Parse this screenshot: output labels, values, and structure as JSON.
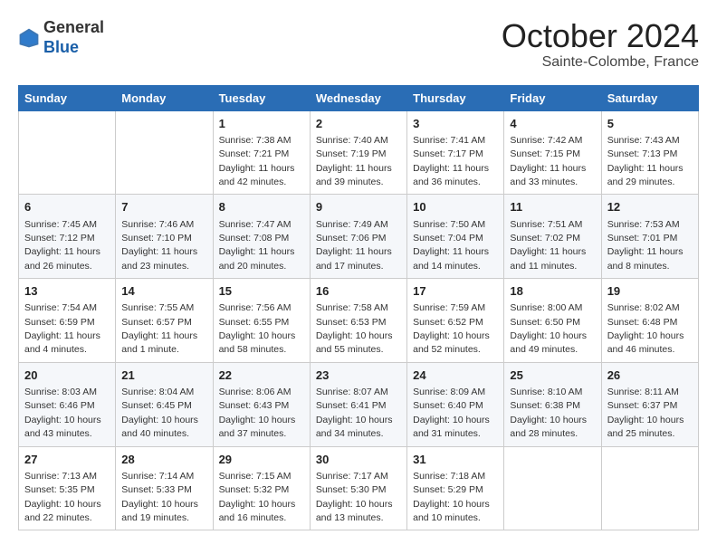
{
  "header": {
    "logo_general": "General",
    "logo_blue": "Blue",
    "month_title": "October 2024",
    "location": "Sainte-Colombe, France"
  },
  "days_of_week": [
    "Sunday",
    "Monday",
    "Tuesday",
    "Wednesday",
    "Thursday",
    "Friday",
    "Saturday"
  ],
  "weeks": [
    [
      {
        "day": "",
        "info": ""
      },
      {
        "day": "",
        "info": ""
      },
      {
        "day": "1",
        "info": "Sunrise: 7:38 AM\nSunset: 7:21 PM\nDaylight: 11 hours and 42 minutes."
      },
      {
        "day": "2",
        "info": "Sunrise: 7:40 AM\nSunset: 7:19 PM\nDaylight: 11 hours and 39 minutes."
      },
      {
        "day": "3",
        "info": "Sunrise: 7:41 AM\nSunset: 7:17 PM\nDaylight: 11 hours and 36 minutes."
      },
      {
        "day": "4",
        "info": "Sunrise: 7:42 AM\nSunset: 7:15 PM\nDaylight: 11 hours and 33 minutes."
      },
      {
        "day": "5",
        "info": "Sunrise: 7:43 AM\nSunset: 7:13 PM\nDaylight: 11 hours and 29 minutes."
      }
    ],
    [
      {
        "day": "6",
        "info": "Sunrise: 7:45 AM\nSunset: 7:12 PM\nDaylight: 11 hours and 26 minutes."
      },
      {
        "day": "7",
        "info": "Sunrise: 7:46 AM\nSunset: 7:10 PM\nDaylight: 11 hours and 23 minutes."
      },
      {
        "day": "8",
        "info": "Sunrise: 7:47 AM\nSunset: 7:08 PM\nDaylight: 11 hours and 20 minutes."
      },
      {
        "day": "9",
        "info": "Sunrise: 7:49 AM\nSunset: 7:06 PM\nDaylight: 11 hours and 17 minutes."
      },
      {
        "day": "10",
        "info": "Sunrise: 7:50 AM\nSunset: 7:04 PM\nDaylight: 11 hours and 14 minutes."
      },
      {
        "day": "11",
        "info": "Sunrise: 7:51 AM\nSunset: 7:02 PM\nDaylight: 11 hours and 11 minutes."
      },
      {
        "day": "12",
        "info": "Sunrise: 7:53 AM\nSunset: 7:01 PM\nDaylight: 11 hours and 8 minutes."
      }
    ],
    [
      {
        "day": "13",
        "info": "Sunrise: 7:54 AM\nSunset: 6:59 PM\nDaylight: 11 hours and 4 minutes."
      },
      {
        "day": "14",
        "info": "Sunrise: 7:55 AM\nSunset: 6:57 PM\nDaylight: 11 hours and 1 minute."
      },
      {
        "day": "15",
        "info": "Sunrise: 7:56 AM\nSunset: 6:55 PM\nDaylight: 10 hours and 58 minutes."
      },
      {
        "day": "16",
        "info": "Sunrise: 7:58 AM\nSunset: 6:53 PM\nDaylight: 10 hours and 55 minutes."
      },
      {
        "day": "17",
        "info": "Sunrise: 7:59 AM\nSunset: 6:52 PM\nDaylight: 10 hours and 52 minutes."
      },
      {
        "day": "18",
        "info": "Sunrise: 8:00 AM\nSunset: 6:50 PM\nDaylight: 10 hours and 49 minutes."
      },
      {
        "day": "19",
        "info": "Sunrise: 8:02 AM\nSunset: 6:48 PM\nDaylight: 10 hours and 46 minutes."
      }
    ],
    [
      {
        "day": "20",
        "info": "Sunrise: 8:03 AM\nSunset: 6:46 PM\nDaylight: 10 hours and 43 minutes."
      },
      {
        "day": "21",
        "info": "Sunrise: 8:04 AM\nSunset: 6:45 PM\nDaylight: 10 hours and 40 minutes."
      },
      {
        "day": "22",
        "info": "Sunrise: 8:06 AM\nSunset: 6:43 PM\nDaylight: 10 hours and 37 minutes."
      },
      {
        "day": "23",
        "info": "Sunrise: 8:07 AM\nSunset: 6:41 PM\nDaylight: 10 hours and 34 minutes."
      },
      {
        "day": "24",
        "info": "Sunrise: 8:09 AM\nSunset: 6:40 PM\nDaylight: 10 hours and 31 minutes."
      },
      {
        "day": "25",
        "info": "Sunrise: 8:10 AM\nSunset: 6:38 PM\nDaylight: 10 hours and 28 minutes."
      },
      {
        "day": "26",
        "info": "Sunrise: 8:11 AM\nSunset: 6:37 PM\nDaylight: 10 hours and 25 minutes."
      }
    ],
    [
      {
        "day": "27",
        "info": "Sunrise: 7:13 AM\nSunset: 5:35 PM\nDaylight: 10 hours and 22 minutes."
      },
      {
        "day": "28",
        "info": "Sunrise: 7:14 AM\nSunset: 5:33 PM\nDaylight: 10 hours and 19 minutes."
      },
      {
        "day": "29",
        "info": "Sunrise: 7:15 AM\nSunset: 5:32 PM\nDaylight: 10 hours and 16 minutes."
      },
      {
        "day": "30",
        "info": "Sunrise: 7:17 AM\nSunset: 5:30 PM\nDaylight: 10 hours and 13 minutes."
      },
      {
        "day": "31",
        "info": "Sunrise: 7:18 AM\nSunset: 5:29 PM\nDaylight: 10 hours and 10 minutes."
      },
      {
        "day": "",
        "info": ""
      },
      {
        "day": "",
        "info": ""
      }
    ]
  ]
}
